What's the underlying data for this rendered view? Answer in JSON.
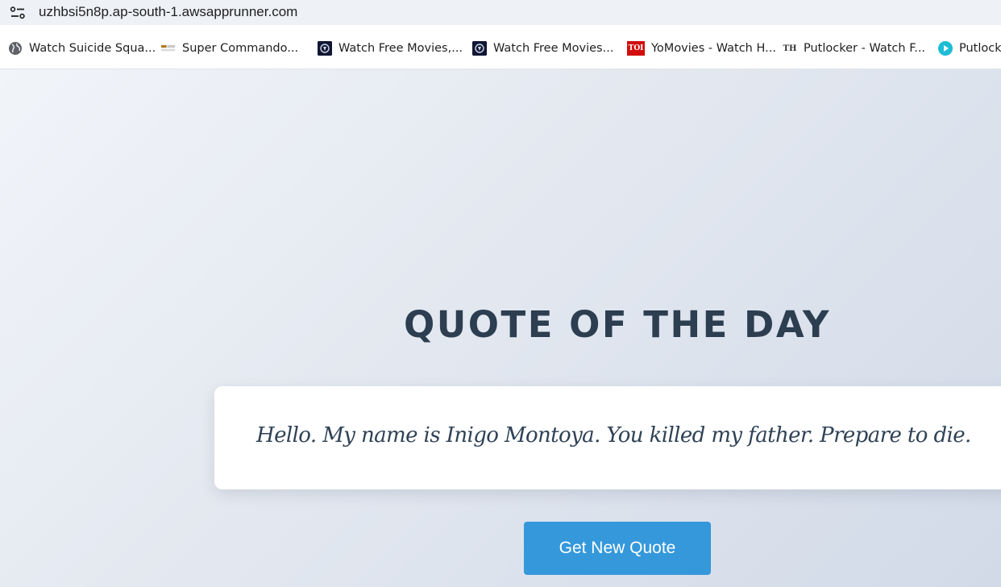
{
  "browser": {
    "url": "uzhbsi5n8p.ap-south-1.awsapprunner.com",
    "bookmarks": [
      {
        "label": "Watch Suicide Squa...",
        "icon": "globe-icon"
      },
      {
        "label": "Super Commando...",
        "icon": "super-commando-favicon"
      },
      {
        "label": "Watch Free Movies,...",
        "icon": "movie-site-favicon"
      },
      {
        "label": "Watch Free Movies...",
        "icon": "movie-site-favicon"
      },
      {
        "label": "YoMovies - Watch H...",
        "icon": "toi-favicon",
        "icon_text": "TOI"
      },
      {
        "label": "Putlocker - Watch F...",
        "icon": "th-favicon",
        "icon_text": "TH"
      },
      {
        "label": "Putlocke",
        "icon": "play-icon"
      }
    ]
  },
  "page": {
    "title": "QUOTE OF THE DAY",
    "quote": "Hello. My name is Inigo Montoya. You killed my father. Prepare to die.",
    "button_label": "Get New Quote"
  },
  "colors": {
    "title": "#2c3e50",
    "button": "#3498db",
    "card": "#ffffff"
  }
}
